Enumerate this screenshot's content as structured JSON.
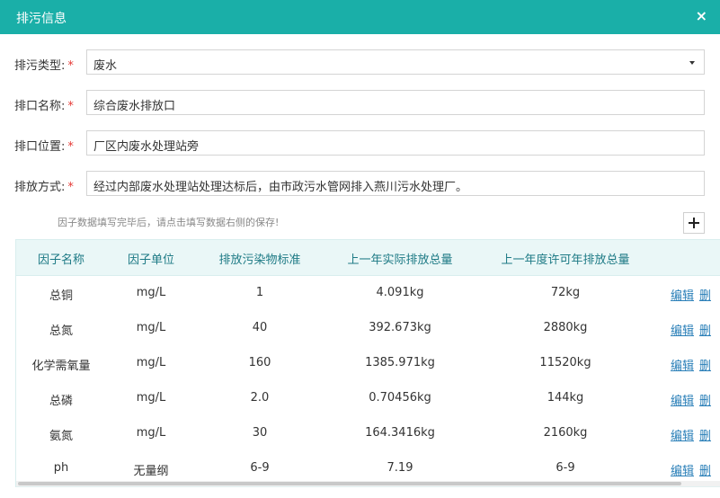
{
  "dialog": {
    "title": "排污信息",
    "close": "×"
  },
  "form": {
    "required_mark": "*",
    "type_label": "排污类型:",
    "type_value": "废水",
    "name_label": "排口名称:",
    "name_value": "综合废水排放口",
    "location_label": "排口位置:",
    "location_value": "厂区内废水处理站旁",
    "method_label": "排放方式:",
    "method_value": "经过内部废水处理站处理达标后，由市政污水管网排入燕川污水处理厂。"
  },
  "hint": "因子数据填写完毕后，请点击填写数据右侧的保存!",
  "add_button": "+",
  "table": {
    "headers": [
      "因子名称",
      "因子单位",
      "排放污染物标准",
      "上一年实际排放总量",
      "上一年度许可年排放总量"
    ],
    "edit_label": "编辑",
    "delete_partial": "删",
    "rows": [
      {
        "name": "总铜",
        "unit": "mg/L",
        "standard": "1",
        "actual": "4.091kg",
        "permitted": "72kg"
      },
      {
        "name": "总氮",
        "unit": "mg/L",
        "standard": "40",
        "actual": "392.673kg",
        "permitted": "2880kg"
      },
      {
        "name": "化学需氧量",
        "unit": "mg/L",
        "standard": "160",
        "actual": "1385.971kg",
        "permitted": "11520kg"
      },
      {
        "name": "总磷",
        "unit": "mg/L",
        "standard": "2.0",
        "actual": "0.70456kg",
        "permitted": "144kg"
      },
      {
        "name": "氨氮",
        "unit": "mg/L",
        "standard": "30",
        "actual": "164.3416kg",
        "permitted": "2160kg"
      },
      {
        "name": "ph",
        "unit": "无量纲",
        "standard": "6-9",
        "actual": "7.19",
        "permitted": "6-9"
      }
    ]
  }
}
